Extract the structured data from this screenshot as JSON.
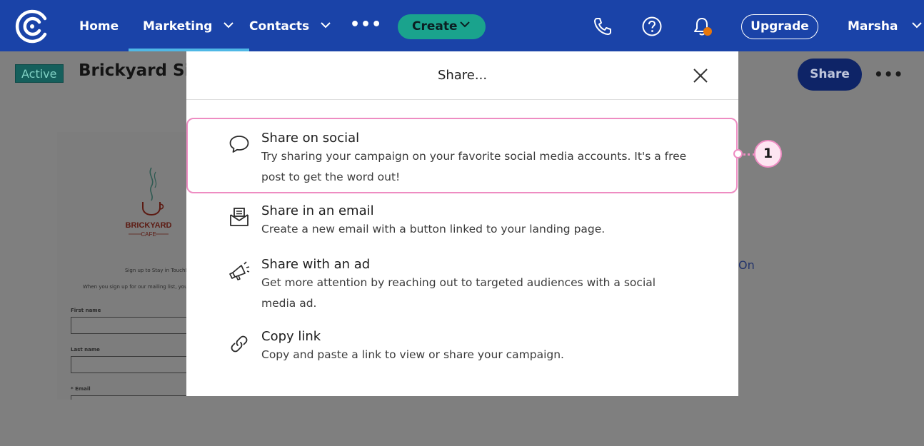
{
  "nav": {
    "home": "Home",
    "marketing": "Marketing",
    "contacts": "Contacts",
    "more": "•••",
    "create": "Create",
    "upgrade": "Upgrade",
    "user": "Marsha"
  },
  "page": {
    "status": "Active",
    "title": "Brickyard Sig",
    "share": "Share",
    "more": "•••"
  },
  "preview": {
    "brand_line1": "BRICKYARD",
    "brand_line2": "CAFE",
    "tagline": "Sign up to Stay in Touch!",
    "intro": "When you sign up for our mailing list, you'll receive",
    "first_name": "First name",
    "last_name": "Last name",
    "email": "* Email"
  },
  "side_fragment": "On",
  "modal": {
    "title": "Share...",
    "options": [
      {
        "title": "Share on social",
        "description": "Try sharing your campaign on your favorite social media accounts. It's a free post to get the word out!",
        "icon": "speech-bubble-icon"
      },
      {
        "title": "Share in an email",
        "description": "Create a new email with a button linked to your landing page.",
        "icon": "envelope-icon"
      },
      {
        "title": "Share with an ad",
        "description": "Get more attention by reaching out to targeted audiences with a social media ad.",
        "icon": "megaphone-icon"
      },
      {
        "title": "Copy link",
        "description": "Copy and paste a link to view or share your campaign.",
        "icon": "link-icon"
      }
    ]
  },
  "callout": {
    "number": "1"
  },
  "colors": {
    "nav_bg": "#1a43a8",
    "create_bg": "#1aa38d",
    "highlight": "#ee8cc2",
    "notification": "#e8770b"
  }
}
